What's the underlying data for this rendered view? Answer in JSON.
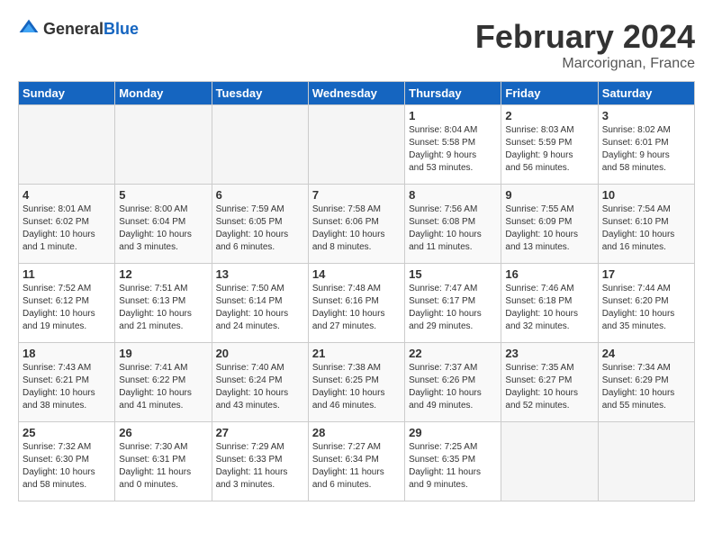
{
  "header": {
    "logo_general": "General",
    "logo_blue": "Blue",
    "title": "February 2024",
    "subtitle": "Marcorignan, France"
  },
  "days_of_week": [
    "Sunday",
    "Monday",
    "Tuesday",
    "Wednesday",
    "Thursday",
    "Friday",
    "Saturday"
  ],
  "weeks": [
    [
      {
        "day": "",
        "info": "",
        "empty": true
      },
      {
        "day": "",
        "info": "",
        "empty": true
      },
      {
        "day": "",
        "info": "",
        "empty": true
      },
      {
        "day": "",
        "info": "",
        "empty": true
      },
      {
        "day": "1",
        "info": "Sunrise: 8:04 AM\nSunset: 5:58 PM\nDaylight: 9 hours\nand 53 minutes.",
        "empty": false
      },
      {
        "day": "2",
        "info": "Sunrise: 8:03 AM\nSunset: 5:59 PM\nDaylight: 9 hours\nand 56 minutes.",
        "empty": false
      },
      {
        "day": "3",
        "info": "Sunrise: 8:02 AM\nSunset: 6:01 PM\nDaylight: 9 hours\nand 58 minutes.",
        "empty": false
      }
    ],
    [
      {
        "day": "4",
        "info": "Sunrise: 8:01 AM\nSunset: 6:02 PM\nDaylight: 10 hours\nand 1 minute.",
        "empty": false
      },
      {
        "day": "5",
        "info": "Sunrise: 8:00 AM\nSunset: 6:04 PM\nDaylight: 10 hours\nand 3 minutes.",
        "empty": false
      },
      {
        "day": "6",
        "info": "Sunrise: 7:59 AM\nSunset: 6:05 PM\nDaylight: 10 hours\nand 6 minutes.",
        "empty": false
      },
      {
        "day": "7",
        "info": "Sunrise: 7:58 AM\nSunset: 6:06 PM\nDaylight: 10 hours\nand 8 minutes.",
        "empty": false
      },
      {
        "day": "8",
        "info": "Sunrise: 7:56 AM\nSunset: 6:08 PM\nDaylight: 10 hours\nand 11 minutes.",
        "empty": false
      },
      {
        "day": "9",
        "info": "Sunrise: 7:55 AM\nSunset: 6:09 PM\nDaylight: 10 hours\nand 13 minutes.",
        "empty": false
      },
      {
        "day": "10",
        "info": "Sunrise: 7:54 AM\nSunset: 6:10 PM\nDaylight: 10 hours\nand 16 minutes.",
        "empty": false
      }
    ],
    [
      {
        "day": "11",
        "info": "Sunrise: 7:52 AM\nSunset: 6:12 PM\nDaylight: 10 hours\nand 19 minutes.",
        "empty": false
      },
      {
        "day": "12",
        "info": "Sunrise: 7:51 AM\nSunset: 6:13 PM\nDaylight: 10 hours\nand 21 minutes.",
        "empty": false
      },
      {
        "day": "13",
        "info": "Sunrise: 7:50 AM\nSunset: 6:14 PM\nDaylight: 10 hours\nand 24 minutes.",
        "empty": false
      },
      {
        "day": "14",
        "info": "Sunrise: 7:48 AM\nSunset: 6:16 PM\nDaylight: 10 hours\nand 27 minutes.",
        "empty": false
      },
      {
        "day": "15",
        "info": "Sunrise: 7:47 AM\nSunset: 6:17 PM\nDaylight: 10 hours\nand 29 minutes.",
        "empty": false
      },
      {
        "day": "16",
        "info": "Sunrise: 7:46 AM\nSunset: 6:18 PM\nDaylight: 10 hours\nand 32 minutes.",
        "empty": false
      },
      {
        "day": "17",
        "info": "Sunrise: 7:44 AM\nSunset: 6:20 PM\nDaylight: 10 hours\nand 35 minutes.",
        "empty": false
      }
    ],
    [
      {
        "day": "18",
        "info": "Sunrise: 7:43 AM\nSunset: 6:21 PM\nDaylight: 10 hours\nand 38 minutes.",
        "empty": false
      },
      {
        "day": "19",
        "info": "Sunrise: 7:41 AM\nSunset: 6:22 PM\nDaylight: 10 hours\nand 41 minutes.",
        "empty": false
      },
      {
        "day": "20",
        "info": "Sunrise: 7:40 AM\nSunset: 6:24 PM\nDaylight: 10 hours\nand 43 minutes.",
        "empty": false
      },
      {
        "day": "21",
        "info": "Sunrise: 7:38 AM\nSunset: 6:25 PM\nDaylight: 10 hours\nand 46 minutes.",
        "empty": false
      },
      {
        "day": "22",
        "info": "Sunrise: 7:37 AM\nSunset: 6:26 PM\nDaylight: 10 hours\nand 49 minutes.",
        "empty": false
      },
      {
        "day": "23",
        "info": "Sunrise: 7:35 AM\nSunset: 6:27 PM\nDaylight: 10 hours\nand 52 minutes.",
        "empty": false
      },
      {
        "day": "24",
        "info": "Sunrise: 7:34 AM\nSunset: 6:29 PM\nDaylight: 10 hours\nand 55 minutes.",
        "empty": false
      }
    ],
    [
      {
        "day": "25",
        "info": "Sunrise: 7:32 AM\nSunset: 6:30 PM\nDaylight: 10 hours\nand 58 minutes.",
        "empty": false
      },
      {
        "day": "26",
        "info": "Sunrise: 7:30 AM\nSunset: 6:31 PM\nDaylight: 11 hours\nand 0 minutes.",
        "empty": false
      },
      {
        "day": "27",
        "info": "Sunrise: 7:29 AM\nSunset: 6:33 PM\nDaylight: 11 hours\nand 3 minutes.",
        "empty": false
      },
      {
        "day": "28",
        "info": "Sunrise: 7:27 AM\nSunset: 6:34 PM\nDaylight: 11 hours\nand 6 minutes.",
        "empty": false
      },
      {
        "day": "29",
        "info": "Sunrise: 7:25 AM\nSunset: 6:35 PM\nDaylight: 11 hours\nand 9 minutes.",
        "empty": false
      },
      {
        "day": "",
        "info": "",
        "empty": true
      },
      {
        "day": "",
        "info": "",
        "empty": true
      }
    ]
  ]
}
